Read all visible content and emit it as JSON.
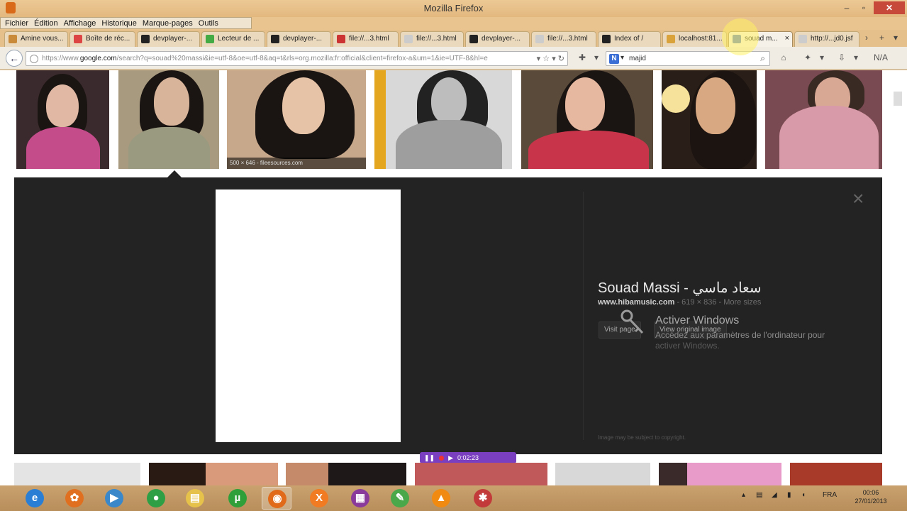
{
  "window": {
    "title": "Mozilla Firefox",
    "min": "–",
    "max": "▫",
    "close": "✕"
  },
  "menu": [
    "Fichier",
    "Édition",
    "Affichage",
    "Historique",
    "Marque-pages",
    "Outils"
  ],
  "tabs": [
    {
      "label": "Amine vous...",
      "icon": "page-icon",
      "color": "#c98a3a"
    },
    {
      "label": "Boîte de réc...",
      "icon": "gmail-icon",
      "color": "#d44"
    },
    {
      "label": "devplayer-...",
      "icon": "terminal-icon",
      "color": "#222"
    },
    {
      "label": "Lecteur de ...",
      "icon": "reader-icon",
      "color": "#4a4"
    },
    {
      "label": "devplayer-...",
      "icon": "terminal-icon",
      "color": "#222"
    },
    {
      "label": "file://...3.html",
      "icon": "warning-icon",
      "color": "#c33"
    },
    {
      "label": "file://...3.html",
      "icon": "page-icon",
      "color": "#ccc"
    },
    {
      "label": "devplayer-...",
      "icon": "terminal-icon",
      "color": "#222"
    },
    {
      "label": "file://...3.html",
      "icon": "page-icon",
      "color": "#ccc"
    },
    {
      "label": "Index of /",
      "icon": "terminal-icon",
      "color": "#222"
    },
    {
      "label": "localhost:81...",
      "icon": "warning-icon",
      "color": "#d9a23a"
    },
    {
      "label": "souad m...",
      "icon": "images-icon",
      "color": "#5b7fbf",
      "active": true,
      "close": "×"
    },
    {
      "label": "http://...jd0.jsf",
      "icon": "page-icon",
      "color": "#ccc"
    }
  ],
  "nav": {
    "url_prefix": "https://www.",
    "url_domain": "google.com",
    "url_rest": "/search?q=souad%20massi&ie=utf-8&oe=utf-8&aq=t&rls=org.mozilla:fr:official&client=firefox-a&um=1&ie=UTF-8&hl=e",
    "search_engine_letter": "N",
    "search_value": "majid",
    "na_label": "N/A"
  },
  "results": {
    "caption": "500 × 646 - fileesources.com"
  },
  "detail": {
    "title": "Souad Massi - سعاد ماسي",
    "site": "www.hibamusic.com",
    "meta": " - 619 × 836 - More sizes",
    "visit_label": "Visit page",
    "view_label": "View original image",
    "close": "×",
    "footnote": "Image may be subject to copyright."
  },
  "windows_notice": {
    "line1": "Activer Windows",
    "line2": "Accédez aux paramètres de l'ordinateur pour",
    "line3": "activer Windows."
  },
  "recorder": {
    "time": "0:02:23"
  },
  "taskbar": {
    "apps": [
      {
        "name": "internet-explorer",
        "glyph": "e",
        "color": "#2a7fd4"
      },
      {
        "name": "app-orange",
        "glyph": "✿",
        "color": "#e07020"
      },
      {
        "name": "media-player",
        "glyph": "▶",
        "color": "#3a88c9"
      },
      {
        "name": "chrome",
        "glyph": "●",
        "color": "#2f9f46"
      },
      {
        "name": "file-explorer",
        "glyph": "▤",
        "color": "#e6c24a"
      },
      {
        "name": "utorrent",
        "glyph": "µ",
        "color": "#2f9f3a"
      },
      {
        "name": "firefox",
        "glyph": "◉",
        "color": "#e06a1a",
        "active": true
      },
      {
        "name": "xampp",
        "glyph": "X",
        "color": "#f07b22"
      },
      {
        "name": "winrar",
        "glyph": "▦",
        "color": "#8a3a9a"
      },
      {
        "name": "notepadpp",
        "glyph": "✎",
        "color": "#4aa84a"
      },
      {
        "name": "vlc",
        "glyph": "▲",
        "color": "#f08a10"
      },
      {
        "name": "app-red",
        "glyph": "✱",
        "color": "#c23a3a"
      }
    ],
    "lang": "FRA",
    "time": "00:06",
    "date": "27/01/2013"
  }
}
